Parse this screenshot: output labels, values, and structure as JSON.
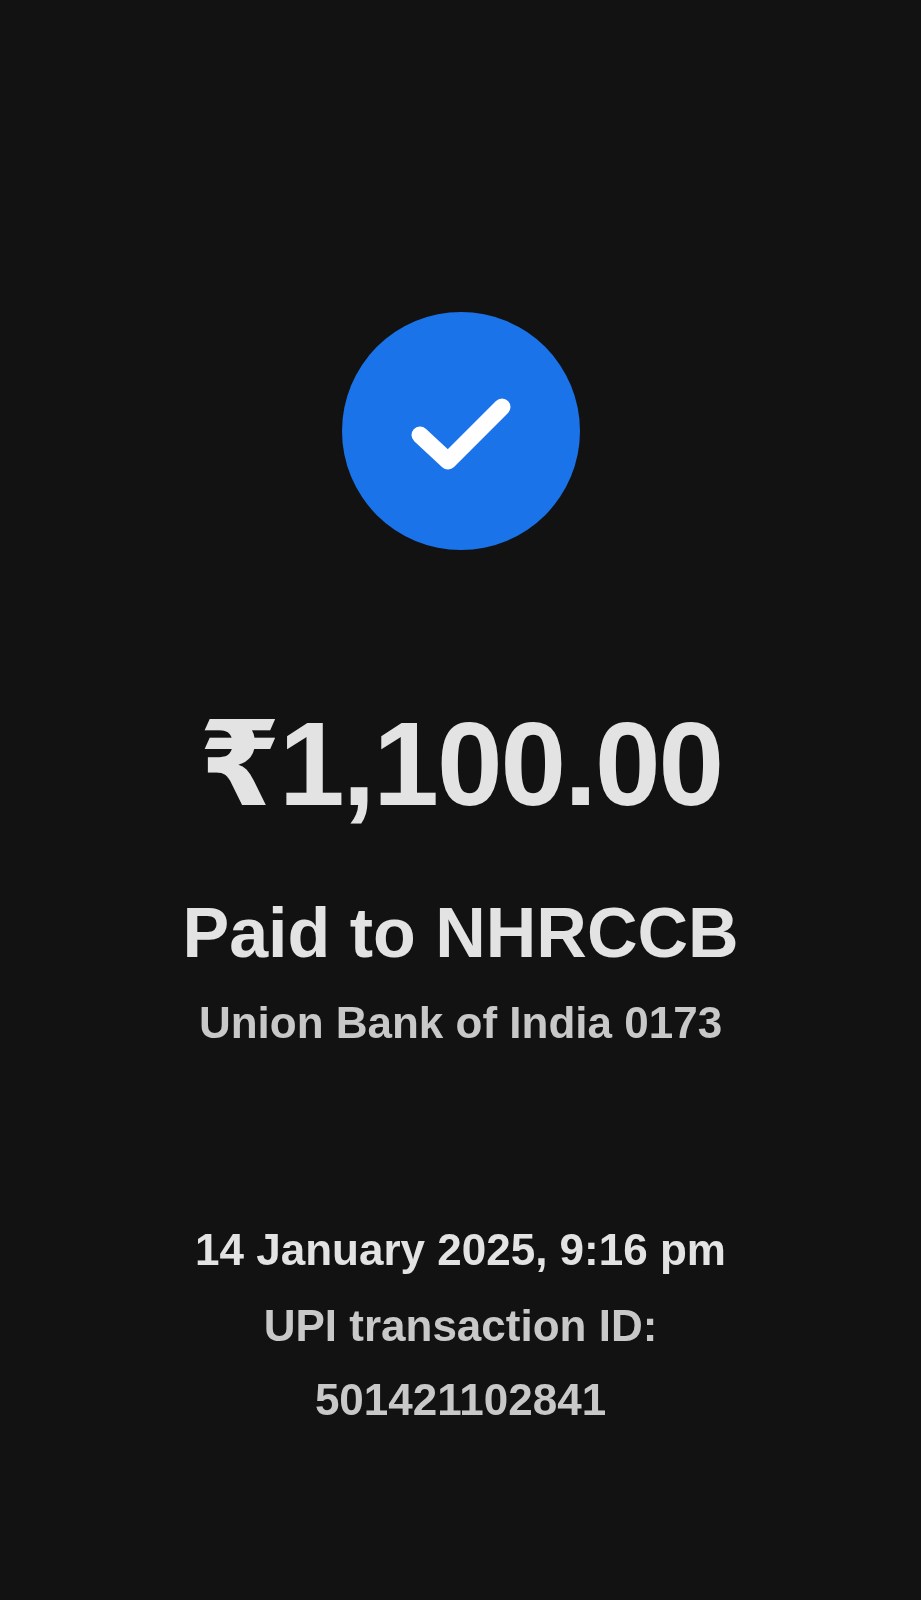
{
  "amount": "₹1,100.00",
  "payee": "Paid to NHRCCB",
  "bank": "Union Bank of India 0173",
  "datetime": "14 January 2025, 9:16 pm",
  "transaction_id": "UPI transaction ID: 501421102841"
}
